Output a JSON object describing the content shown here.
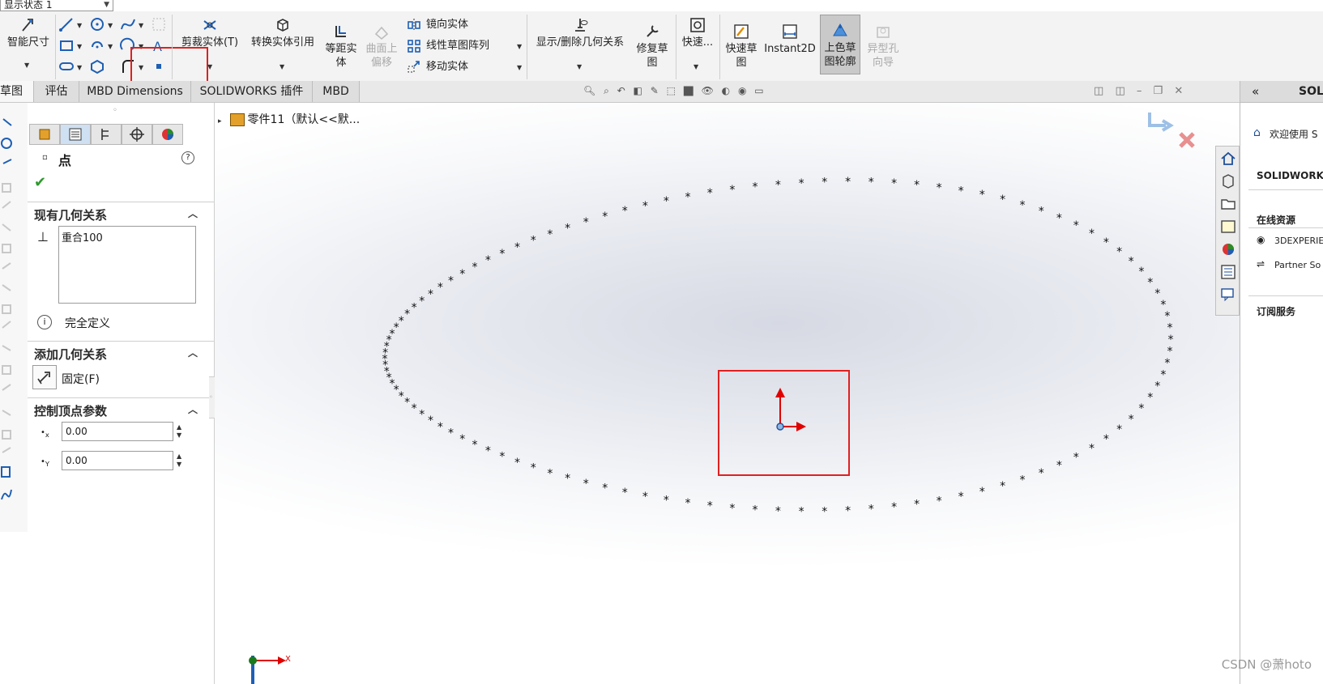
{
  "display_state": {
    "label": "显示状态 1"
  },
  "ribbon": {
    "smart_dimension": "智能尺寸",
    "trim_entities": "剪裁实体(T)",
    "convert_entities": "转换实体引用",
    "offset_entities_1": "等距实",
    "offset_entities_2": "体",
    "offset_on_surface_1": "曲面上",
    "offset_on_surface_2": "偏移",
    "mirror_entities": "镜向实体",
    "linear_pattern": "线性草图阵列",
    "move_entities": "移动实体",
    "display_delete_relations": "显示/删除几何关系",
    "repair_sketch_1": "修复草",
    "repair_sketch_2": "图",
    "quick_snaps": "快速...",
    "rapid_sketch_1": "快速草",
    "rapid_sketch_2": "图",
    "instant2d": "Instant2D",
    "shaded_contours_1": "上色草",
    "shaded_contours_2": "图轮廓",
    "hole_wizard_1": "异型孔",
    "hole_wizard_2": "向导"
  },
  "tabs": [
    "草图",
    "评估",
    "MBD Dimensions",
    "SOLIDWORKS 插件",
    "MBD"
  ],
  "property_manager": {
    "title": "点",
    "help": "?",
    "existing_relations": {
      "heading": "现有几何关系",
      "items": [
        "重合100"
      ],
      "status": "完全定义"
    },
    "add_relations": {
      "heading": "添加几何关系",
      "fix_label": "固定(F)"
    },
    "parameters": {
      "heading": "控制顶点参数",
      "x_value": "0.00",
      "y_value": "0.00",
      "x_sub": "x",
      "y_sub": "Y"
    }
  },
  "graphics": {
    "tree_node": "零件11（默认<<默...",
    "triad_x_label": "X",
    "sketch_point_count": 110
  },
  "task_pane": {
    "header": "SOL",
    "welcome": "欢迎使用 S",
    "solidworks_heading": "SOLIDWORKS",
    "online_resources": "在线资源",
    "link_3dx": "3DEXPERIE",
    "link_partner": "Partner So",
    "subscription": "订阅服务",
    "collapse_symbol": "«"
  },
  "watermark": "CSDN @萧hoto",
  "colors": {
    "accent_red": "#e02020",
    "origin_red": "#e00000",
    "ribbon_bg": "#f3f3f3"
  }
}
